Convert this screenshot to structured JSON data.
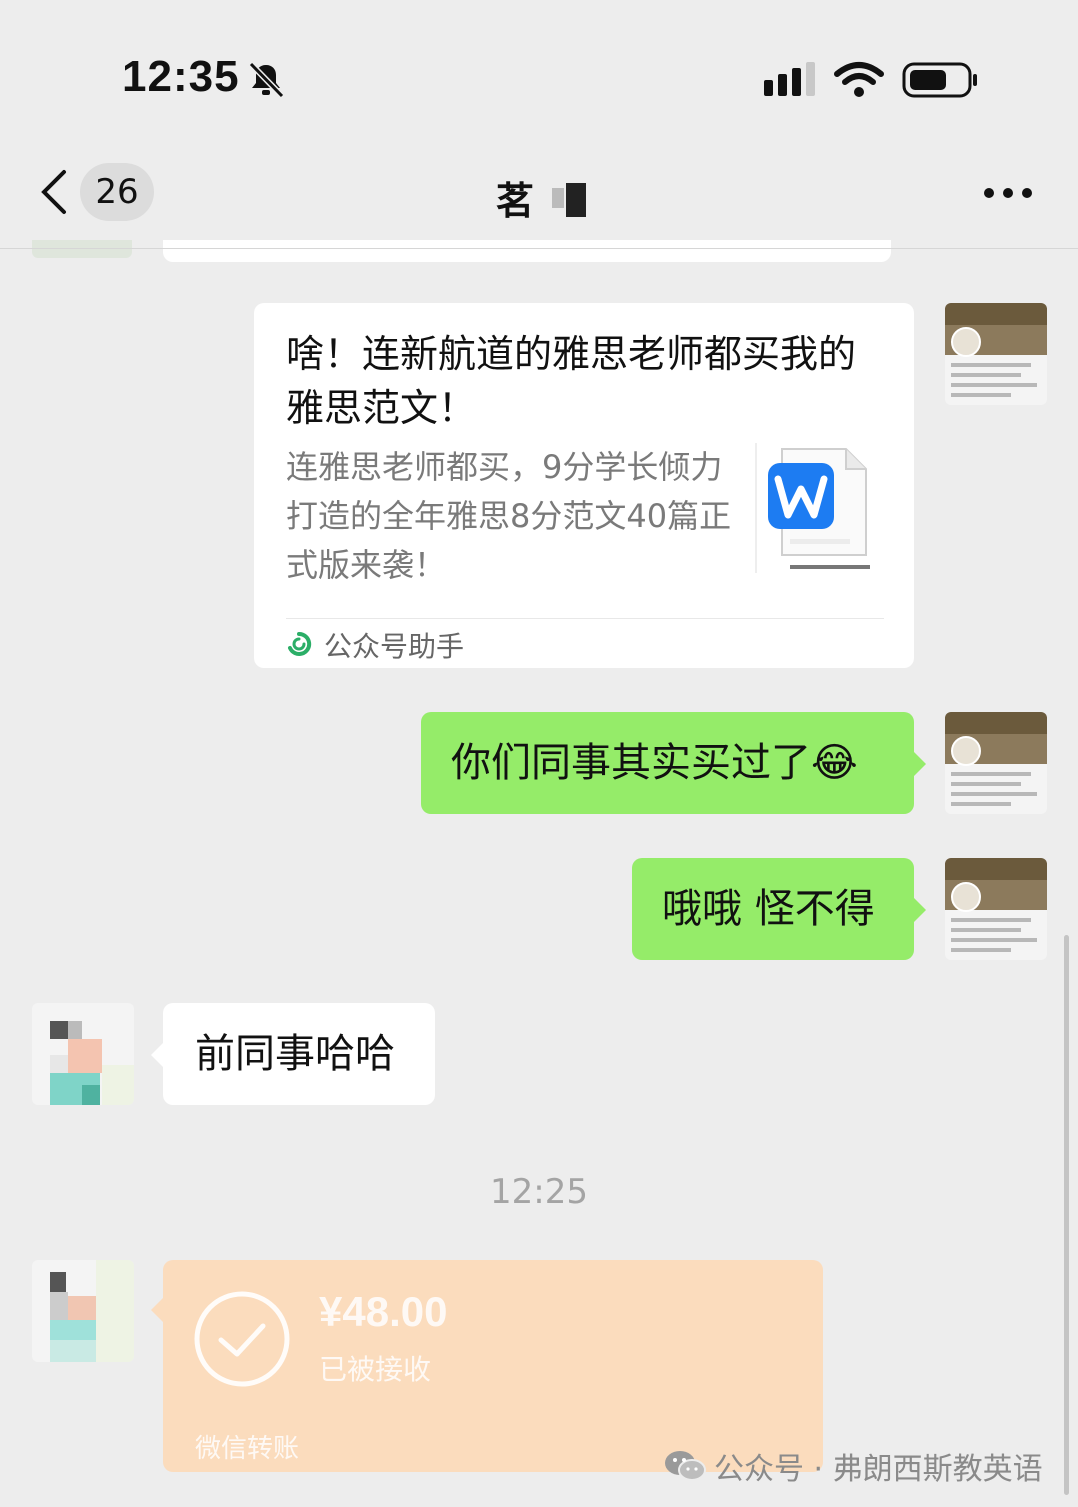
{
  "status_bar": {
    "time": "12:35",
    "icons": [
      "bell-muted-icon",
      "signal-icon",
      "wifi-icon",
      "battery-icon"
    ]
  },
  "nav": {
    "back_icon": "chevron-left-icon",
    "unread_count": "26",
    "title": "茗",
    "more_icon": "more-dots-icon"
  },
  "messages": {
    "article_card": {
      "title": "啥！连新航道的雅思老师都买我的雅思范文！",
      "description": "连雅思老师都买，9分学长倾力打造的全年雅思8分范文40篇正式版来袭！",
      "source": "公众号助手",
      "thumbnail_icon": "word-document-icon"
    },
    "me_1": "你们同事其实买过了😂",
    "me_2": "哦哦 怪不得",
    "peer_1": "前同事哈哈",
    "timestamp": "12:25",
    "transfer": {
      "amount": "¥48.00",
      "status": "已被接收",
      "label": "微信转账"
    }
  },
  "watermark": {
    "text": "公众号 · 弗朗西斯教英语"
  },
  "colors": {
    "background": "#ededed",
    "my_bubble": "#95ec69",
    "peer_bubble": "#ffffff",
    "transfer": "#fbdcbd",
    "muted_text": "#7a7a7a"
  }
}
